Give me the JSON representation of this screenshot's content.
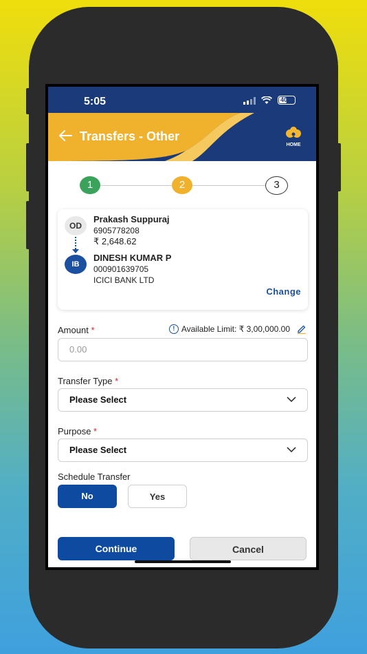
{
  "status_bar": {
    "time": "5:05",
    "battery": "40"
  },
  "header": {
    "title": "Transfers - Other",
    "home_label": "HOME"
  },
  "stepper": {
    "steps": [
      "1",
      "2",
      "3"
    ],
    "current": 2
  },
  "accounts": {
    "from": {
      "type_badge": "OD",
      "name": "Prakash Suppuraj",
      "number": "6905778208",
      "balance": "₹ 2,648.62"
    },
    "to": {
      "type_badge": "IB",
      "name": "DINESH KUMAR P",
      "number": "000901639705",
      "bank": "ICICI BANK LTD"
    },
    "change_label": "Change"
  },
  "amount": {
    "label": "Amount",
    "required_mark": "*",
    "placeholder": "0.00",
    "available_limit": "Available Limit: ₹ 3,00,000.00"
  },
  "transfer_type": {
    "label": "Transfer Type",
    "required_mark": "*",
    "value": "Please Select"
  },
  "purpose": {
    "label": "Purpose",
    "required_mark": "*",
    "value": "Please Select"
  },
  "schedule": {
    "label": "Schedule Transfer",
    "no_label": "No",
    "yes_label": "Yes",
    "selected": "No"
  },
  "footer": {
    "continue_label": "Continue",
    "cancel_label": "Cancel"
  },
  "colors": {
    "primary": "#0d4aa0",
    "header_bg": "#1a3a7a",
    "accent": "#f0b12c",
    "step_done": "#3aa25a",
    "required": "#d3262d"
  }
}
